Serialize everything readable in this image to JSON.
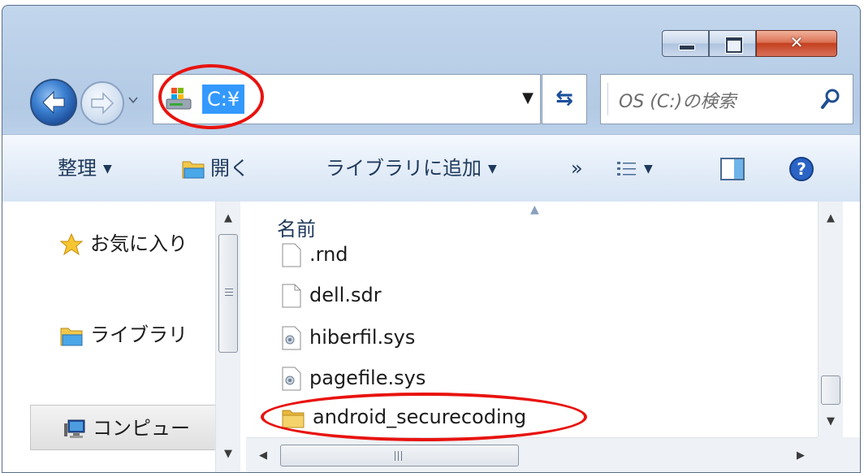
{
  "window": {
    "controls": {
      "minimize_icon": "minimize-icon",
      "maximize_icon": "maximize-icon",
      "close_glyph": "✕"
    }
  },
  "address_bar": {
    "path": "C:¥",
    "dropdown_glyph": "▼",
    "refresh_glyph": "⇆"
  },
  "search": {
    "placeholder": "OS (C:)の検索"
  },
  "toolbar": {
    "organize": "整理",
    "open": "開く",
    "add_to_library": "ライブラリに追加",
    "more": "»",
    "arrow": "▼"
  },
  "navigation": {
    "items": [
      {
        "label": "お気に入り",
        "icon": "star-icon"
      },
      {
        "label": "ライブラリ",
        "icon": "library-icon"
      },
      {
        "label": "コンピュー",
        "icon": "computer-icon"
      }
    ]
  },
  "file_list": {
    "column_name": "名前",
    "files": [
      {
        "name": ".rnd",
        "icon": "file-icon"
      },
      {
        "name": "dell.sdr",
        "icon": "file-icon"
      },
      {
        "name": "hiberfil.sys",
        "icon": "system-file-icon"
      },
      {
        "name": "pagefile.sys",
        "icon": "system-file-icon"
      },
      {
        "name": "android_securecoding",
        "icon": "folder-icon"
      }
    ]
  },
  "colors": {
    "selection": "#3399ff",
    "annotation": "#e8130f",
    "toolbar_text": "#1e395b"
  }
}
